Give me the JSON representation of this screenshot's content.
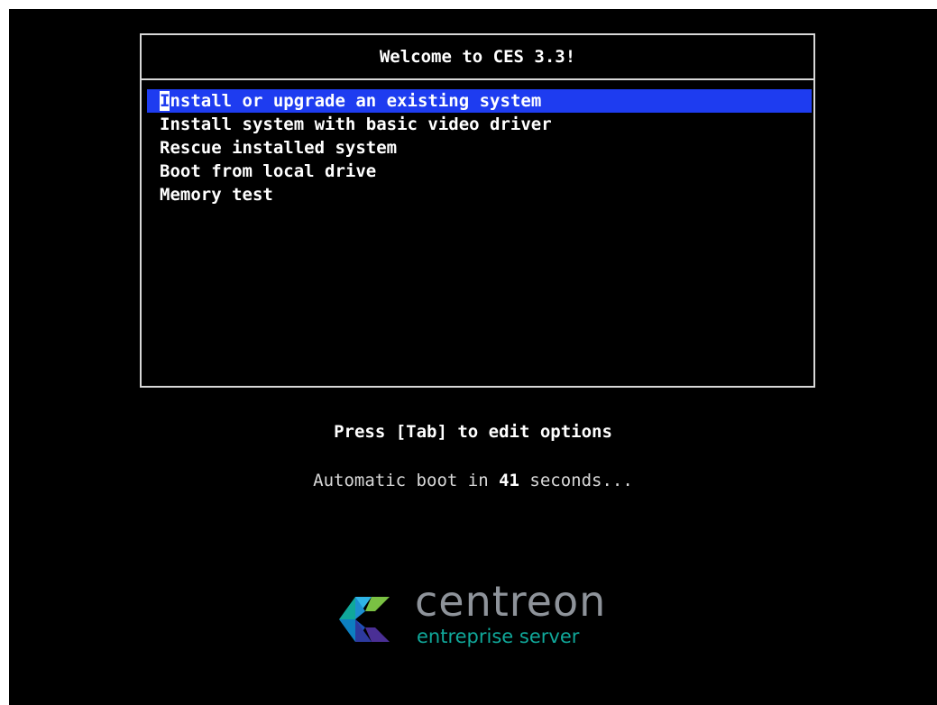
{
  "window": {
    "title": "Welcome to CES 3.3!"
  },
  "menu": {
    "items": [
      {
        "label_first": "I",
        "label_rest": "nstall or upgrade an existing system",
        "selected": true
      },
      {
        "label": "Install system with basic video driver",
        "selected": false
      },
      {
        "label": "Rescue installed system",
        "selected": false
      },
      {
        "label": "Boot from local drive",
        "selected": false
      },
      {
        "label": "Memory test",
        "selected": false
      }
    ]
  },
  "footer": {
    "tab_hint": "Press [Tab] to edit options",
    "auto_prefix": "Automatic boot in ",
    "auto_count": "41",
    "auto_suffix": " seconds..."
  },
  "logo": {
    "wordmark": "centreon",
    "tagline": "entreprise server",
    "icon": "centreon-logo-icon"
  },
  "colors": {
    "background": "#000000",
    "highlight": "#1e3cf0",
    "border": "#d8d8d8",
    "logo_gray": "#8e939a",
    "logo_teal": "#10a89a"
  }
}
